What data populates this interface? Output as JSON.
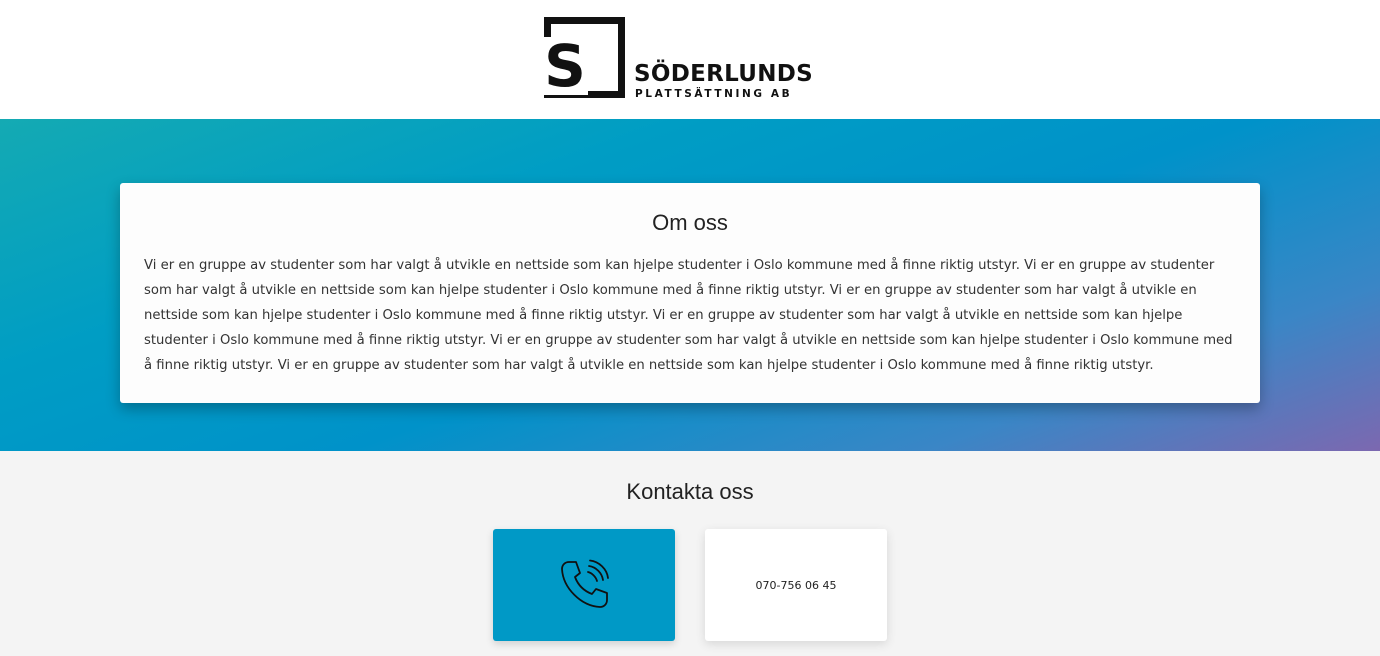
{
  "header": {
    "logo_letter": "S",
    "logo_name": "SÖDERLUNDS",
    "logo_subtitle": "PLATTSÄTTNING AB"
  },
  "about": {
    "title": "Om oss",
    "text": "Vi er en gruppe av studenter som har valgt å utvikle en nettside som kan hjelpe studenter i Oslo kommune med å finne riktig utstyr. Vi er en gruppe av studenter som har valgt å utvikle en nettside som kan hjelpe studenter i Oslo kommune med å finne riktig utstyr. Vi er en gruppe av studenter som har valgt å utvikle en nettside som kan hjelpe studenter i Oslo kommune med å finne riktig utstyr. Vi er en gruppe av studenter som har valgt å utvikle en nettside som kan hjelpe studenter i Oslo kommune med å finne riktig utstyr. Vi er en gruppe av studenter som har valgt å utvikle en nettside som kan hjelpe studenter i Oslo kommune med å finne riktig utstyr. Vi er en gruppe av studenter som har valgt å utvikle en nettside som kan hjelpe studenter i Oslo kommune med å finne riktig utstyr."
  },
  "contact": {
    "title": "Kontakta oss",
    "icon": "phone-call-icon",
    "phone": "070-756 06 45"
  },
  "colors": {
    "accent": "#0099c6",
    "gradient_start": "#14aab3",
    "gradient_end": "#7c68b0"
  }
}
